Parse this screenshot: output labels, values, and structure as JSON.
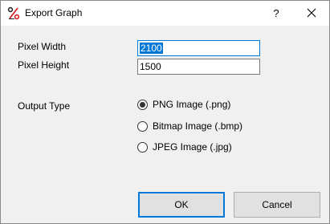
{
  "window": {
    "title": "Export Graph",
    "help_label": "?",
    "icon": "percent-chart-icon",
    "close_icon": "close-icon"
  },
  "form": {
    "pixel_width": {
      "label": "Pixel Width",
      "value": "2100"
    },
    "pixel_height": {
      "label": "Pixel Height",
      "value": "1500"
    },
    "output_type": {
      "label": "Output Type",
      "options": [
        {
          "label": "PNG Image (.png)",
          "selected": true
        },
        {
          "label": "Bitmap Image (.bmp)",
          "selected": false
        },
        {
          "label": "JPEG Image (.jpg)",
          "selected": false
        }
      ]
    }
  },
  "buttons": {
    "ok": "OK",
    "cancel": "Cancel"
  },
  "colors": {
    "accent": "#0078d7",
    "dialog_bg": "#f0f0f0",
    "icon_red": "#d62020",
    "icon_dark": "#2a2a2a"
  }
}
